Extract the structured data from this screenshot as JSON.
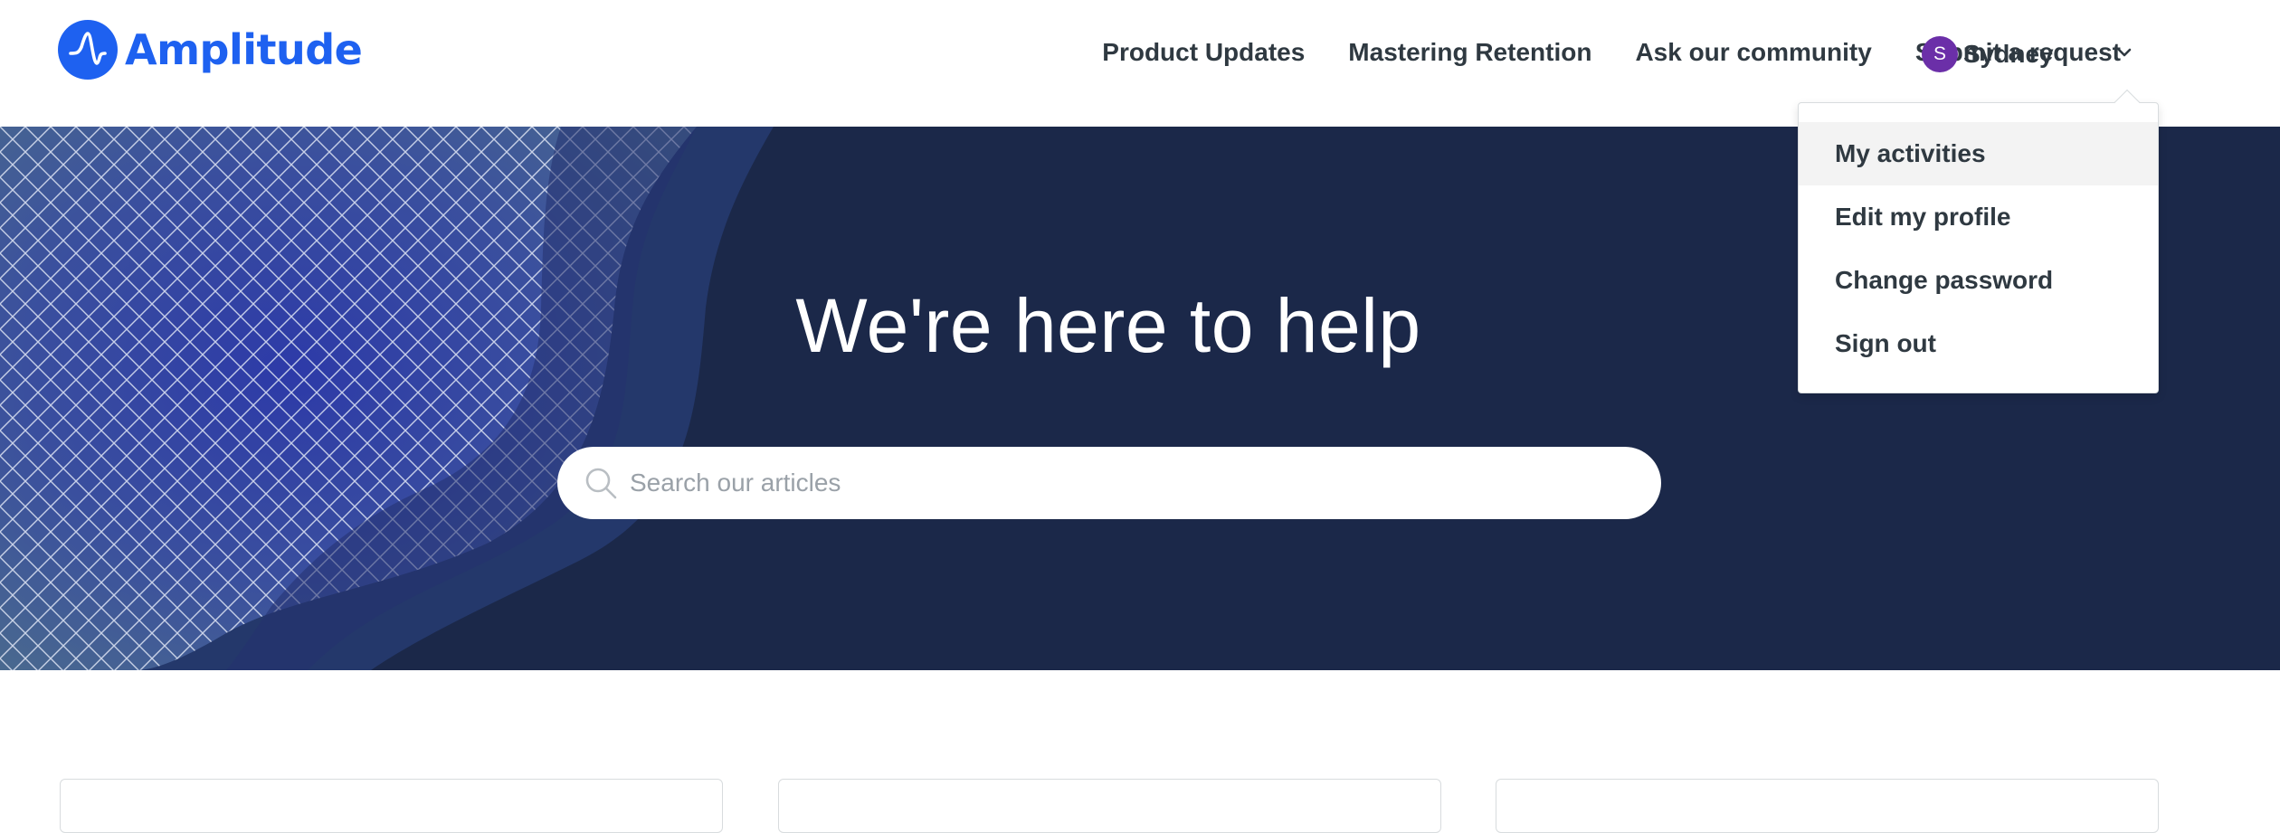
{
  "brand": {
    "name": "Amplitude",
    "color": "#1e61f0",
    "logo_icon": "amplitude-wave-icon"
  },
  "nav": {
    "items": [
      {
        "label": "Product Updates"
      },
      {
        "label": "Mastering Retention"
      },
      {
        "label": "Ask our community"
      },
      {
        "label": "Submit a request"
      }
    ]
  },
  "user": {
    "initial": "S",
    "name": "Sydney",
    "avatar_color": "#6b2fa8",
    "menu_icon": "chevron-down-icon"
  },
  "user_menu": {
    "items": [
      {
        "label": "My activities",
        "active": true
      },
      {
        "label": "Edit my profile"
      },
      {
        "label": "Change password"
      },
      {
        "label": "Sign out"
      }
    ]
  },
  "hero": {
    "title": "We're here to help",
    "background": "#1b2849",
    "search": {
      "placeholder": "Search our articles",
      "value": "",
      "icon": "search-icon"
    }
  },
  "cards": {
    "count_visible": 3
  }
}
